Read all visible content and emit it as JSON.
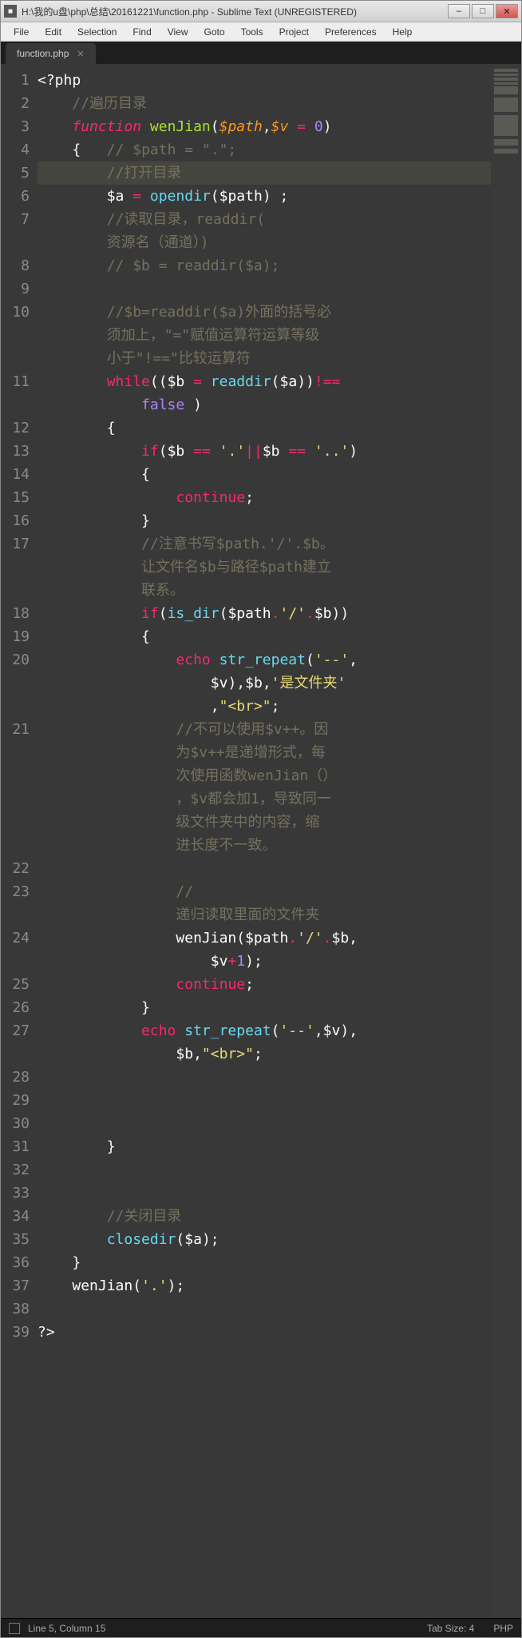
{
  "window": {
    "title": "H:\\我的u盘\\php\\总结\\20161221\\function.php - Sublime Text (UNREGISTERED)"
  },
  "menu": {
    "items": [
      "File",
      "Edit",
      "Selection",
      "Find",
      "View",
      "Goto",
      "Tools",
      "Project",
      "Preferences",
      "Help"
    ]
  },
  "tab": {
    "name": "function.php"
  },
  "gutter_lines": "1\n2\n3\n4\n5\n6\n7\n\n8\n9\n10\n\n\n11\n\n12\n13\n14\n15\n16\n17\n\n\n18\n19\n20\n\n\n21\n\n\n\n\n\n22\n23\n\n24\n\n25\n26\n27\n\n28\n29\n30\n31\n32\n33\n34\n35\n36\n37\n38\n39",
  "code": {
    "l1_open": "<?php",
    "l2_c": "//遍历目录",
    "l3_kw": "function",
    "l3_fn": "wenJian",
    "l3_p1": "$path",
    "l3_p2": "$v",
    "l3_n0": "0",
    "l4_c": "// $path = \".\";",
    "l5_c": "//打开目录",
    "l6_a": "$a",
    "l6_fn": "opendir",
    "l6_arg": "$path",
    "l7_c1": "//读取目录，readdir(",
    "l7_c2": "资源名（通道）)",
    "l8_c": "// $b = readdir($a);",
    "l10_c1": "//$b=readdir($a)外面的括号必",
    "l10_c2": "须加上，\"=\"赋值运算符运算等级",
    "l10_c3": "小于\"!==\"比较运算符",
    "l11_kw": "while",
    "l11_b": "$b",
    "l11_fn": "readdir",
    "l11_arg": "$a",
    "l11_false": "false",
    "l13_kw": "if",
    "l13_b": "$b",
    "l13_s1": "'.'",
    "l13_s2": "'..'",
    "l15_kw": "continue",
    "l17_c1": "//注意书写$path.'/'.$b。",
    "l17_c2": "让文件名$b与路径$path建立",
    "l17_c3": "联系。",
    "l18_kw": "if",
    "l18_fn": "is_dir",
    "l18_p": "$path",
    "l18_s": "'/'",
    "l18_b": "$b",
    "l20_kw": "echo",
    "l20_fn": "str_repeat",
    "l20_s1": "'--'",
    "l20_v": "$v",
    "l20_b": "$b",
    "l20_s2": "'是文件夹'",
    "l20_s3": "\"<br>\"",
    "l21_c1": "//不可以使用$v++。因",
    "l21_c2": "为$v++是递增形式，每",
    "l21_c3": "次使用函数wenJian（）",
    "l21_c4": "，$v都会加1，导致同一",
    "l21_c5": "级文件夹中的内容，缩",
    "l21_c6": "进长度不一致。",
    "l23_c1": "//",
    "l23_c2": "递归读取里面的文件夹",
    "l24_fn": "wenJian",
    "l24_p": "$path",
    "l24_s": "'/'",
    "l24_b": "$b",
    "l24_v": "$v",
    "l24_n": "1",
    "l25_kw": "continue",
    "l27_kw": "echo",
    "l27_fn": "str_repeat",
    "l27_s1": "'--'",
    "l27_v": "$v",
    "l27_b": "$b",
    "l27_s2": "\"<br>\"",
    "l34_c": "//关闭目录",
    "l35_fn": "closedir",
    "l35_a": "$a",
    "l37_fn": "wenJian",
    "l37_s": "'.'",
    "l39_close": "?>"
  },
  "status": {
    "pos": "Line 5, Column 15",
    "tabsize": "Tab Size: 4",
    "lang": "PHP"
  }
}
